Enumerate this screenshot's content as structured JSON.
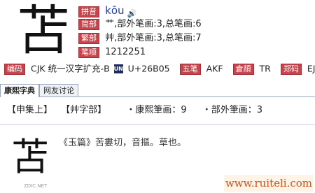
{
  "character": "苫",
  "pinyin": {
    "label": "拼音",
    "value": "kōu"
  },
  "simplified": {
    "label": "简部",
    "value": "艹,部外笔画:3,总笔画:6"
  },
  "traditional": {
    "label": "繁部",
    "value": "艸,部外笔画:3,总笔画:7"
  },
  "strokes": {
    "label": "笔顺",
    "value": "1212251"
  },
  "meta": {
    "encoding_label": "编码",
    "encoding_value": "CJK 统一汉字扩充-B",
    "unicode_icon": "UN",
    "unicode_value": "U+26B05",
    "wubi_label": "五笔",
    "wubi_value": "AKF",
    "cangjie_label": "倉頡",
    "cangjie_value": "TR",
    "zhengma_label": "郑码",
    "zhengma_value": "EJVV"
  },
  "tabs": [
    "康熙字典",
    "网友讨论"
  ],
  "kangxi": {
    "collection": "【申集上】",
    "radical": "【艸字部】",
    "strokes": "・康熙筆画：9",
    "radical_strokes": "・部外筆画：3"
  },
  "definition": "《玉篇》苦婁切，音摳。草也。",
  "watermark_small": "ZDIC.NET",
  "watermark": "www.ruiteli.com",
  "colors": {
    "badge": "#c8434b",
    "watermark": "#d1551b"
  }
}
